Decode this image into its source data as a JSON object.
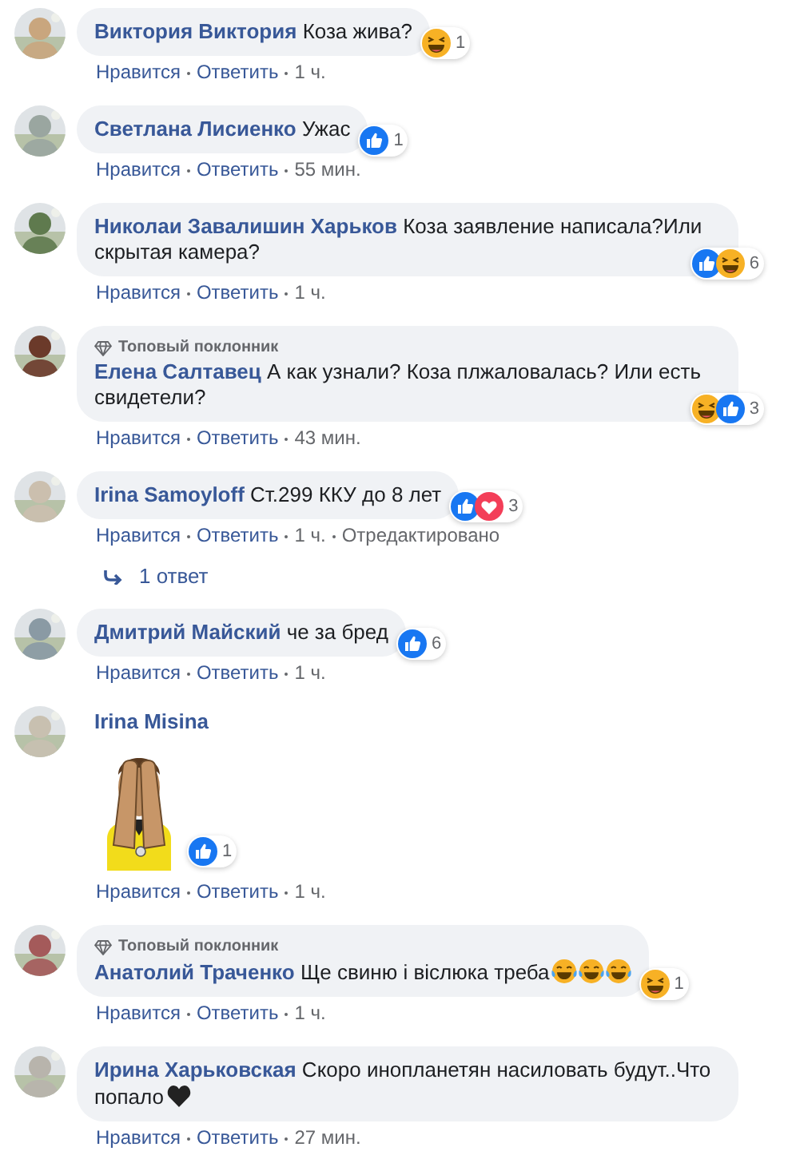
{
  "comments": [
    {
      "kind": "text",
      "author": "Виктория Виктория",
      "text": "Коза жива?",
      "reactions": [
        {
          "kind": "haha"
        }
      ],
      "reaction_count": "1",
      "actions": {
        "like": "Нравится",
        "reply": "Ответить",
        "time": "1 ч."
      }
    },
    {
      "kind": "text",
      "author": "Светлана Лисиенко",
      "text": "Ужас",
      "reactions": [
        {
          "kind": "like"
        }
      ],
      "reaction_count": "1",
      "actions": {
        "like": "Нравится",
        "reply": "Ответить",
        "time": "55 мин."
      }
    },
    {
      "kind": "text",
      "author": "Николаи Завалишин Харьков",
      "text": "Коза заявление написала?Или скрытая камера?",
      "reactions": [
        {
          "kind": "like"
        },
        {
          "kind": "haha"
        }
      ],
      "reaction_count": "6",
      "actions": {
        "like": "Нравится",
        "reply": "Ответить",
        "time": "1 ч."
      }
    },
    {
      "kind": "text",
      "badge": "Топовый поклонник",
      "author": "Елена Салтавец",
      "text": "А как узнали? Коза плжаловалась? Или есть свидетели?",
      "reactions": [
        {
          "kind": "haha"
        },
        {
          "kind": "like"
        }
      ],
      "reaction_count": "3",
      "actions": {
        "like": "Нравится",
        "reply": "Ответить",
        "time": "43 мин."
      }
    },
    {
      "kind": "text",
      "author": "Irina Samoyloff",
      "text": "Ст.299 ККУ до 8 лет",
      "reactions": [
        {
          "kind": "like"
        },
        {
          "kind": "love"
        }
      ],
      "reaction_count": "3",
      "actions": {
        "like": "Нравится",
        "reply": "Ответить",
        "time": "1 ч.",
        "edited": "Отредактировано"
      },
      "replies_link": "1 ответ"
    },
    {
      "kind": "text",
      "author": "Дмитрий Майский",
      "text": "че за бред",
      "reactions": [
        {
          "kind": "like"
        }
      ],
      "reaction_count": "6",
      "actions": {
        "like": "Нравится",
        "reply": "Ответить",
        "time": "1 ч."
      }
    },
    {
      "kind": "sticker",
      "author": "Irina Misina",
      "reactions": [
        {
          "kind": "like"
        }
      ],
      "reaction_count": "1",
      "actions": {
        "like": "Нравится",
        "reply": "Ответить",
        "time": "1 ч."
      }
    },
    {
      "kind": "text",
      "badge": "Топовый поклонник",
      "author": "Анатолий Траченко",
      "text": "Ще свиню і віслюка треба",
      "emojis": [
        {
          "kind": "tears_of_joy"
        },
        {
          "kind": "tears_of_joy"
        },
        {
          "kind": "tears_of_joy"
        }
      ],
      "reactions": [
        {
          "kind": "haha"
        }
      ],
      "reaction_count": "1",
      "actions": {
        "like": "Нравится",
        "reply": "Ответить",
        "time": "1 ч."
      }
    },
    {
      "kind": "text",
      "author": "Ирина Харьковская",
      "text": "Скоро инопланетян насиловать будут..Что попало",
      "emojis": [
        {
          "kind": "black_heart"
        }
      ],
      "actions": {
        "like": "Нравится",
        "reply": "Ответить",
        "time": "27 мин."
      }
    }
  ]
}
